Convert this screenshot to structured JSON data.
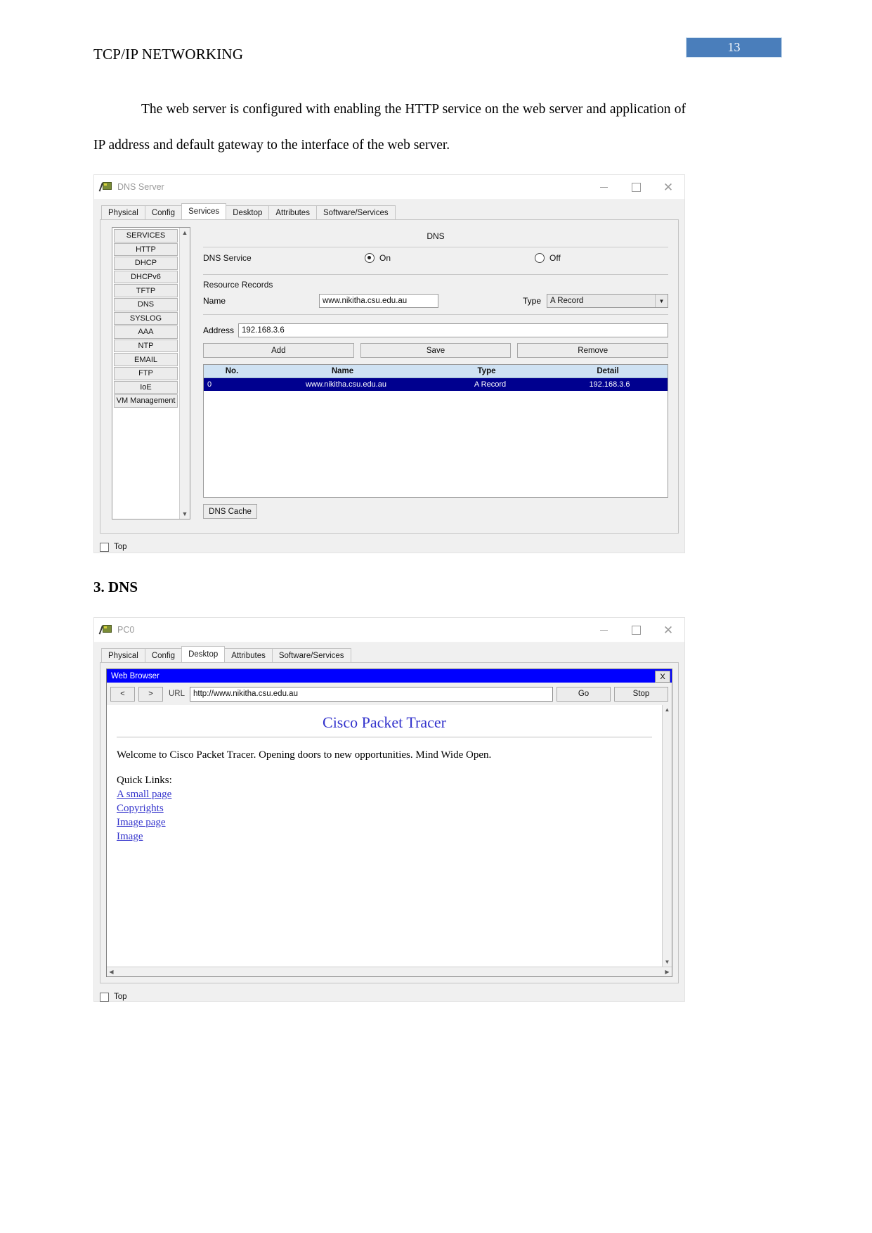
{
  "document": {
    "header_title": "TCP/IP NETWORKING",
    "page_number": "13",
    "paragraph_1": "The web server is configured with enabling the HTTP service on the web server and application of IP address and default gateway to the interface of the web server.",
    "section_heading": "3. DNS"
  },
  "dns_window": {
    "title": "DNS Server",
    "tabs": [
      {
        "label": "Physical",
        "active": false
      },
      {
        "label": "Config",
        "active": false
      },
      {
        "label": "Services",
        "active": true
      },
      {
        "label": "Desktop",
        "active": false
      },
      {
        "label": "Attributes",
        "active": false
      },
      {
        "label": "Software/Services",
        "active": false
      }
    ],
    "services": [
      "SERVICES",
      "HTTP",
      "DHCP",
      "DHCPv6",
      "TFTP",
      "DNS",
      "SYSLOG",
      "AAA",
      "NTP",
      "EMAIL",
      "FTP",
      "IoE",
      "VM Management"
    ],
    "panel_heading": "DNS",
    "service_row_label": "DNS Service",
    "radio_on": "On",
    "radio_off": "Off",
    "radio_selected": "On",
    "resource_records_label": "Resource Records",
    "name_label": "Name",
    "name_value": "www.nikitha.csu.edu.au",
    "type_label": "Type",
    "type_value": "A Record",
    "address_label": "Address",
    "address_value": "192.168.3.6",
    "buttons": {
      "add": "Add",
      "save": "Save",
      "remove": "Remove"
    },
    "table": {
      "headers": [
        "No.",
        "Name",
        "Type",
        "Detail"
      ],
      "rows": [
        {
          "no": "0",
          "name": "www.nikitha.csu.edu.au",
          "type": "A Record",
          "detail": "192.168.3.6"
        }
      ]
    },
    "dns_cache_button": "DNS Cache",
    "footer_checkbox_label": "Top"
  },
  "pc_window": {
    "title": "PC0",
    "tabs": [
      {
        "label": "Physical",
        "active": false
      },
      {
        "label": "Config",
        "active": false
      },
      {
        "label": "Desktop",
        "active": true
      },
      {
        "label": "Attributes",
        "active": false
      },
      {
        "label": "Software/Services",
        "active": false
      }
    ],
    "browser": {
      "title": "Web Browser",
      "close_label": "X",
      "back_label": "<",
      "forward_label": ">",
      "url_label": "URL",
      "url_value": "http://www.nikitha.csu.edu.au",
      "go_label": "Go",
      "stop_label": "Stop",
      "page_title": "Cisco Packet Tracer",
      "welcome_text": "Welcome to Cisco Packet Tracer. Opening doors to new opportunities. Mind Wide Open.",
      "quick_links_label": "Quick Links:",
      "links": [
        "A small page",
        "Copyrights",
        "Image page",
        "Image"
      ]
    },
    "footer_checkbox_label": "Top"
  },
  "colors": {
    "page_badge": "#4a7ebb",
    "table_header": "#cfe2f3",
    "table_selected_row": "#00008f",
    "browser_titlebar": "#0000ff",
    "link": "#3333cc"
  }
}
